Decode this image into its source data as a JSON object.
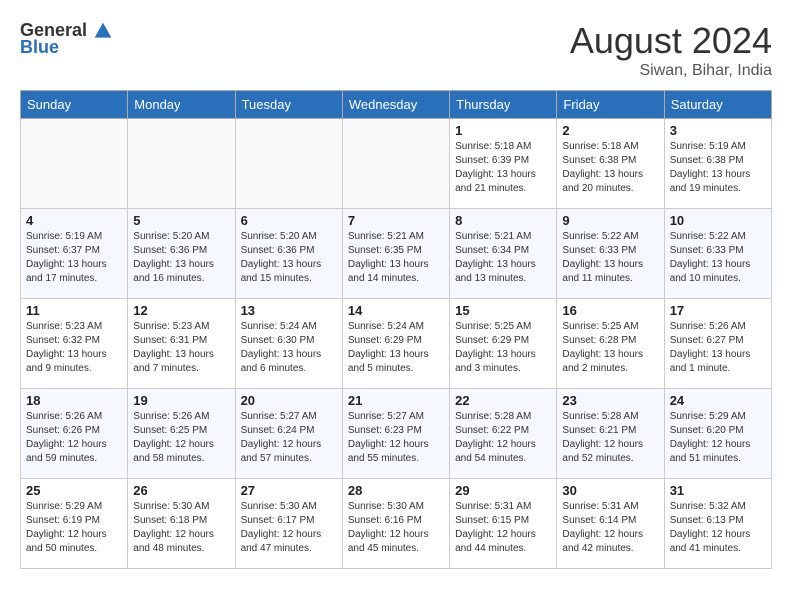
{
  "header": {
    "logo_general": "General",
    "logo_blue": "Blue",
    "month_year": "August 2024",
    "location": "Siwan, Bihar, India"
  },
  "weekdays": [
    "Sunday",
    "Monday",
    "Tuesday",
    "Wednesday",
    "Thursday",
    "Friday",
    "Saturday"
  ],
  "weeks": [
    [
      {
        "day": "",
        "info": ""
      },
      {
        "day": "",
        "info": ""
      },
      {
        "day": "",
        "info": ""
      },
      {
        "day": "",
        "info": ""
      },
      {
        "day": "1",
        "info": "Sunrise: 5:18 AM\nSunset: 6:39 PM\nDaylight: 13 hours\nand 21 minutes."
      },
      {
        "day": "2",
        "info": "Sunrise: 5:18 AM\nSunset: 6:38 PM\nDaylight: 13 hours\nand 20 minutes."
      },
      {
        "day": "3",
        "info": "Sunrise: 5:19 AM\nSunset: 6:38 PM\nDaylight: 13 hours\nand 19 minutes."
      }
    ],
    [
      {
        "day": "4",
        "info": "Sunrise: 5:19 AM\nSunset: 6:37 PM\nDaylight: 13 hours\nand 17 minutes."
      },
      {
        "day": "5",
        "info": "Sunrise: 5:20 AM\nSunset: 6:36 PM\nDaylight: 13 hours\nand 16 minutes."
      },
      {
        "day": "6",
        "info": "Sunrise: 5:20 AM\nSunset: 6:36 PM\nDaylight: 13 hours\nand 15 minutes."
      },
      {
        "day": "7",
        "info": "Sunrise: 5:21 AM\nSunset: 6:35 PM\nDaylight: 13 hours\nand 14 minutes."
      },
      {
        "day": "8",
        "info": "Sunrise: 5:21 AM\nSunset: 6:34 PM\nDaylight: 13 hours\nand 13 minutes."
      },
      {
        "day": "9",
        "info": "Sunrise: 5:22 AM\nSunset: 6:33 PM\nDaylight: 13 hours\nand 11 minutes."
      },
      {
        "day": "10",
        "info": "Sunrise: 5:22 AM\nSunset: 6:33 PM\nDaylight: 13 hours\nand 10 minutes."
      }
    ],
    [
      {
        "day": "11",
        "info": "Sunrise: 5:23 AM\nSunset: 6:32 PM\nDaylight: 13 hours\nand 9 minutes."
      },
      {
        "day": "12",
        "info": "Sunrise: 5:23 AM\nSunset: 6:31 PM\nDaylight: 13 hours\nand 7 minutes."
      },
      {
        "day": "13",
        "info": "Sunrise: 5:24 AM\nSunset: 6:30 PM\nDaylight: 13 hours\nand 6 minutes."
      },
      {
        "day": "14",
        "info": "Sunrise: 5:24 AM\nSunset: 6:29 PM\nDaylight: 13 hours\nand 5 minutes."
      },
      {
        "day": "15",
        "info": "Sunrise: 5:25 AM\nSunset: 6:29 PM\nDaylight: 13 hours\nand 3 minutes."
      },
      {
        "day": "16",
        "info": "Sunrise: 5:25 AM\nSunset: 6:28 PM\nDaylight: 13 hours\nand 2 minutes."
      },
      {
        "day": "17",
        "info": "Sunrise: 5:26 AM\nSunset: 6:27 PM\nDaylight: 13 hours\nand 1 minute."
      }
    ],
    [
      {
        "day": "18",
        "info": "Sunrise: 5:26 AM\nSunset: 6:26 PM\nDaylight: 12 hours\nand 59 minutes."
      },
      {
        "day": "19",
        "info": "Sunrise: 5:26 AM\nSunset: 6:25 PM\nDaylight: 12 hours\nand 58 minutes."
      },
      {
        "day": "20",
        "info": "Sunrise: 5:27 AM\nSunset: 6:24 PM\nDaylight: 12 hours\nand 57 minutes."
      },
      {
        "day": "21",
        "info": "Sunrise: 5:27 AM\nSunset: 6:23 PM\nDaylight: 12 hours\nand 55 minutes."
      },
      {
        "day": "22",
        "info": "Sunrise: 5:28 AM\nSunset: 6:22 PM\nDaylight: 12 hours\nand 54 minutes."
      },
      {
        "day": "23",
        "info": "Sunrise: 5:28 AM\nSunset: 6:21 PM\nDaylight: 12 hours\nand 52 minutes."
      },
      {
        "day": "24",
        "info": "Sunrise: 5:29 AM\nSunset: 6:20 PM\nDaylight: 12 hours\nand 51 minutes."
      }
    ],
    [
      {
        "day": "25",
        "info": "Sunrise: 5:29 AM\nSunset: 6:19 PM\nDaylight: 12 hours\nand 50 minutes."
      },
      {
        "day": "26",
        "info": "Sunrise: 5:30 AM\nSunset: 6:18 PM\nDaylight: 12 hours\nand 48 minutes."
      },
      {
        "day": "27",
        "info": "Sunrise: 5:30 AM\nSunset: 6:17 PM\nDaylight: 12 hours\nand 47 minutes."
      },
      {
        "day": "28",
        "info": "Sunrise: 5:30 AM\nSunset: 6:16 PM\nDaylight: 12 hours\nand 45 minutes."
      },
      {
        "day": "29",
        "info": "Sunrise: 5:31 AM\nSunset: 6:15 PM\nDaylight: 12 hours\nand 44 minutes."
      },
      {
        "day": "30",
        "info": "Sunrise: 5:31 AM\nSunset: 6:14 PM\nDaylight: 12 hours\nand 42 minutes."
      },
      {
        "day": "31",
        "info": "Sunrise: 5:32 AM\nSunset: 6:13 PM\nDaylight: 12 hours\nand 41 minutes."
      }
    ]
  ]
}
